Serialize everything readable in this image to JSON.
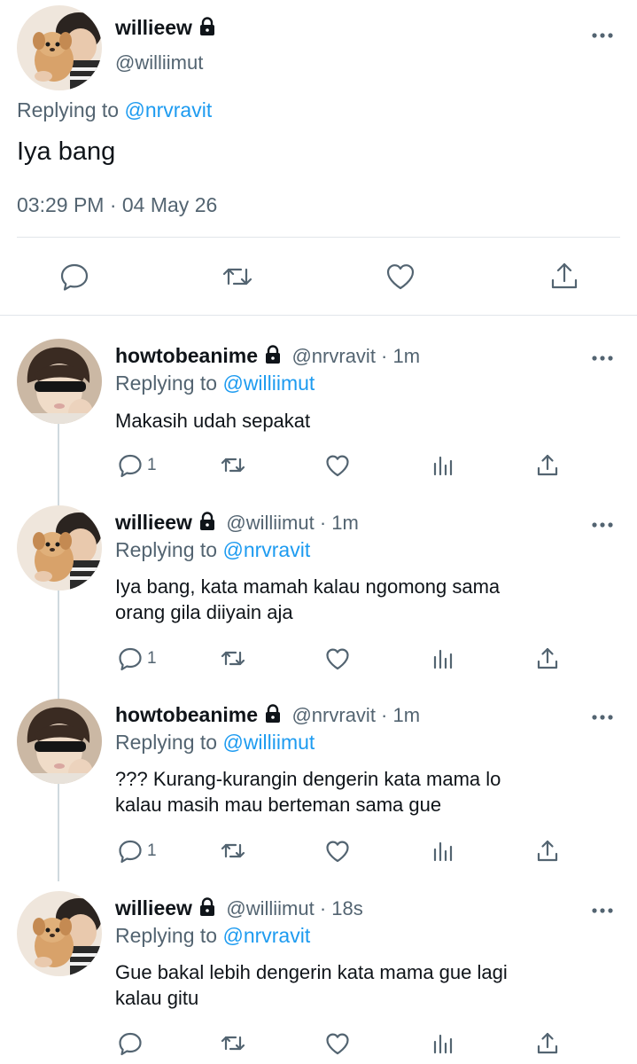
{
  "main_tweet": {
    "display_name": "willieew",
    "handle": "@williimut",
    "replying_label": "Replying to",
    "replying_handle": "@nrvravit",
    "text": "Iya bang",
    "timestamp": "03:29 PM · 04 May 26"
  },
  "replies": [
    {
      "display_name": "howtobeanime",
      "meta": "@nrvravit · 1m",
      "replying_label": "Replying to",
      "replying_handle": "@williimut",
      "text_lines": [
        "Makasih udah sepakat"
      ],
      "reply_count": "1"
    },
    {
      "display_name": "willieew",
      "meta": "@williimut · 1m",
      "replying_label": "Replying to",
      "replying_handle": "@nrvravit",
      "text_lines": [
        "Iya bang, kata mamah kalau ngomong sama",
        "orang gila diiyain aja"
      ],
      "reply_count": "1"
    },
    {
      "display_name": "howtobeanime",
      "meta": "@nrvravit · 1m",
      "replying_label": "Replying to",
      "replying_handle": "@williimut",
      "text_lines": [
        "??? Kurang-kurangin dengerin kata mama lo",
        "kalau masih mau berteman sama gue"
      ],
      "reply_count": "1"
    },
    {
      "display_name": "willieew",
      "meta": "@williimut · 18s",
      "replying_label": "Replying to",
      "replying_handle": "@nrvravit",
      "text_lines": [
        "Gue bakal lebih dengerin kata mama gue lagi",
        "kalau gitu"
      ],
      "reply_count": ""
    }
  ],
  "icons": {
    "lock": "lock-icon",
    "more": "more-icon",
    "reply": "reply-icon",
    "retweet": "retweet-icon",
    "like": "like-icon",
    "views": "views-icon",
    "share": "share-icon"
  },
  "colors": {
    "link": "#1d9bf0",
    "secondary_text": "#536471",
    "divider": "#e1e5ea"
  }
}
